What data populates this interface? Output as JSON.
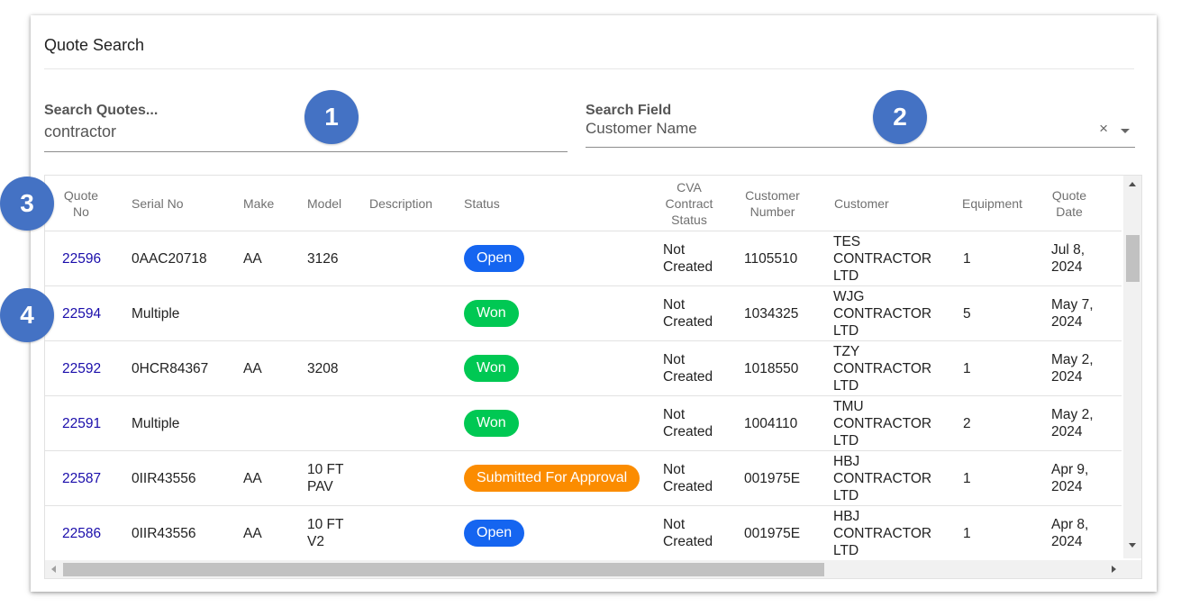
{
  "card": {
    "title": "Quote Search"
  },
  "search": {
    "label": "Search Quotes...",
    "value": "contractor"
  },
  "search_field": {
    "label": "Search Field",
    "value": "Customer Name",
    "clear": "×"
  },
  "markers": [
    "1",
    "2",
    "3",
    "4"
  ],
  "columns": {
    "quote_no": "Quote No",
    "serial_no": "Serial No",
    "make": "Make",
    "model": "Model",
    "description": "Description",
    "status": "Status",
    "cva_status": "CVA Contract Status",
    "customer_number": "Customer Number",
    "customer": "Customer",
    "equipment": "Equipment",
    "quote_date": "Quote Date"
  },
  "status_colors": {
    "Open": "#1565f0",
    "Won": "#00c853",
    "Submitted For Approval": "#fb8c00"
  },
  "rows": [
    {
      "quote_no": "22596",
      "serial_no": "0AAC20718",
      "make": "AA",
      "model": "3126",
      "description": "",
      "status": "Open",
      "cva_status": "Not Created",
      "customer_number": "1105510",
      "customer": "TES CONTRACTOR LTD",
      "equipment": "1",
      "quote_date": "Jul 8, 2024"
    },
    {
      "quote_no": "22594",
      "serial_no": "Multiple",
      "make": "",
      "model": "",
      "description": "",
      "status": "Won",
      "cva_status": "Not Created",
      "customer_number": "1034325",
      "customer": "WJG CONTRACTOR LTD",
      "equipment": "5",
      "quote_date": "May 7, 2024"
    },
    {
      "quote_no": "22592",
      "serial_no": "0HCR84367",
      "make": "AA",
      "model": "3208",
      "description": "",
      "status": "Won",
      "cva_status": "Not Created",
      "customer_number": "1018550",
      "customer": "TZY CONTRACTOR LTD",
      "equipment": "1",
      "quote_date": "May 2, 2024"
    },
    {
      "quote_no": "22591",
      "serial_no": "Multiple",
      "make": "",
      "model": "",
      "description": "",
      "status": "Won",
      "cva_status": "Not Created",
      "customer_number": "1004110",
      "customer": "TMU CONTRACTOR LTD",
      "equipment": "2",
      "quote_date": "May 2, 2024"
    },
    {
      "quote_no": "22587",
      "serial_no": "0IIR43556",
      "make": "AA",
      "model": "10 FT PAV",
      "description": "",
      "status": "Submitted For Approval",
      "cva_status": "Not Created",
      "customer_number": "001975E",
      "customer": "HBJ CONTRACTOR LTD",
      "equipment": "1",
      "quote_date": "Apr 9, 2024"
    },
    {
      "quote_no": "22586",
      "serial_no": "0IIR43556",
      "make": "AA",
      "model": "10 FT V2",
      "description": "",
      "status": "Open",
      "cva_status": "Not Created",
      "customer_number": "001975E",
      "customer": "HBJ CONTRACTOR LTD",
      "equipment": "1",
      "quote_date": "Apr 8, 2024"
    }
  ]
}
